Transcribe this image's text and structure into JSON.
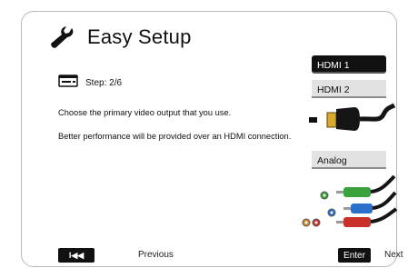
{
  "header": {
    "title": "Easy Setup",
    "icon": "wrench-icon"
  },
  "step": {
    "icon": "tray-icon",
    "label": "Step: 2/6"
  },
  "instructions": {
    "line1": "Choose the primary video output that you use.",
    "line2": "Better performance will be provided over an HDMI connection."
  },
  "options": {
    "hdmi1": "HDMI 1",
    "hdmi2": "HDMI 2",
    "analog": "Analog",
    "selected": "HDMI 1"
  },
  "footer": {
    "prev_icon": "skip-back-icon",
    "prev_button": "I◀◀",
    "prev_label": "Previous",
    "enter_button": "Enter",
    "next_label": "Next"
  },
  "colors": {
    "selected_bg": "#111111",
    "option_bg": "#e2e2e2",
    "rca_green": "#3aa23a",
    "rca_blue": "#2a6fc9",
    "rca_red": "#c9302a"
  }
}
